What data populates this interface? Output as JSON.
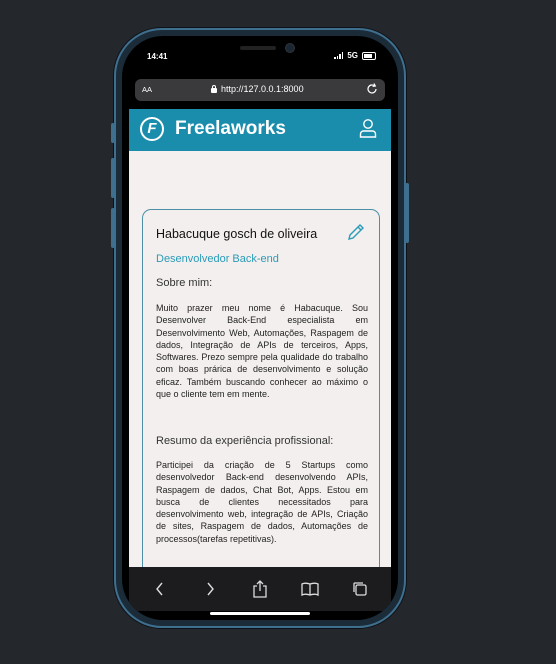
{
  "status": {
    "time": "14:41",
    "network": "5G"
  },
  "browser": {
    "text_size": "AA",
    "url": "http://127.0.0.1:8000"
  },
  "app": {
    "brand": "Freelaworks",
    "logo_letter": "F"
  },
  "profile": {
    "name": "Habacuque gosch de oliveira",
    "role": "Desenvolvedor Back-end",
    "about_heading": "Sobre mim:",
    "about_text": "Muito prazer meu nome é Habacuque. Sou Desenvolver Back-End especialista em Desenvolvimento Web, Automações, Raspagem de dados, Integração de APIs de terceiros, Apps, Softwares. Prezo sempre pela qualidade do trabalho com boas prárica de desenvolvimento e solução eficaz. Também buscando conhecer ao máximo o que o cliente tem em mente.",
    "experience_heading": "Resumo da experiência profissional:",
    "experience_text": "Participei da criação de 5 Startups como desenvolvedor Back-end desenvolvendo APIs, Raspagem de dados, Chat Bot, Apps. Estou em busca de clientes necessitados para desenvolvimento web, integração de APIs, Criação de sites, Raspagem de dados, Automações de processos(tarefas repetitivas)."
  },
  "colors": {
    "header": "#1b8dac",
    "accent": "#2a9bb8",
    "card_border": "#4d8fa6"
  },
  "icons": [
    "user-icon",
    "pencil-icon",
    "back-icon",
    "forward-icon",
    "share-icon",
    "bookmarks-icon",
    "tabs-icon"
  ]
}
